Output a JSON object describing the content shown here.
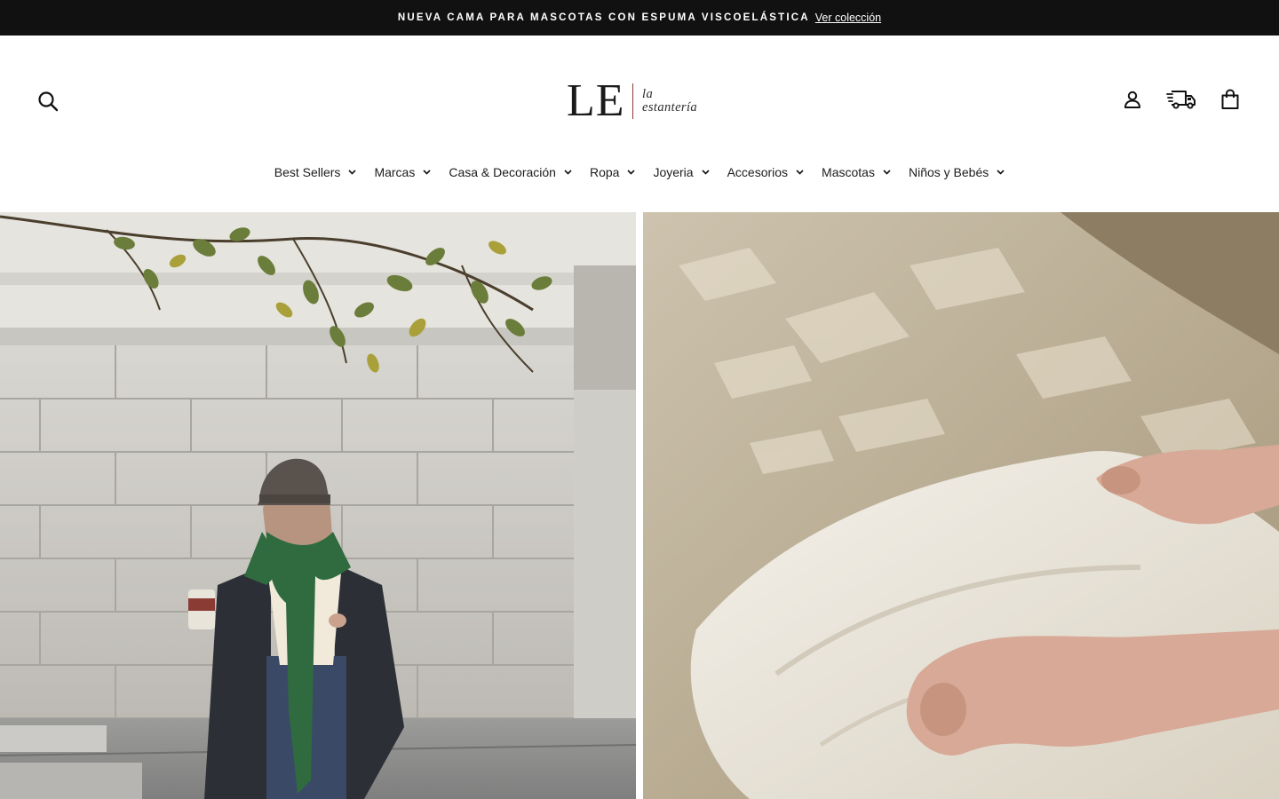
{
  "announcement": {
    "text": "NUEVA CAMA PARA MASCOTAS CON ESPUMA VISCOELÁSTICA",
    "link": "Ver colección"
  },
  "header": {
    "logo": {
      "mark": "LE",
      "line1": "la",
      "line2": "estantería"
    },
    "icons": {
      "search": "search-icon",
      "account": "user-icon",
      "shipping": "delivery-truck-icon",
      "cart": "shopping-bag-icon"
    }
  },
  "nav": {
    "items": [
      {
        "label": "Best Sellers"
      },
      {
        "label": "Marcas"
      },
      {
        "label": "Casa & Decoración"
      },
      {
        "label": "Ropa"
      },
      {
        "label": "Joyeria"
      },
      {
        "label": "Accesorios"
      },
      {
        "label": "Mascotas"
      },
      {
        "label": "Niños y Bebés"
      }
    ]
  },
  "colors": {
    "announcement_bg": "#111111",
    "text": "#1c1c1c",
    "logo_accent": "#8c3a3a"
  }
}
